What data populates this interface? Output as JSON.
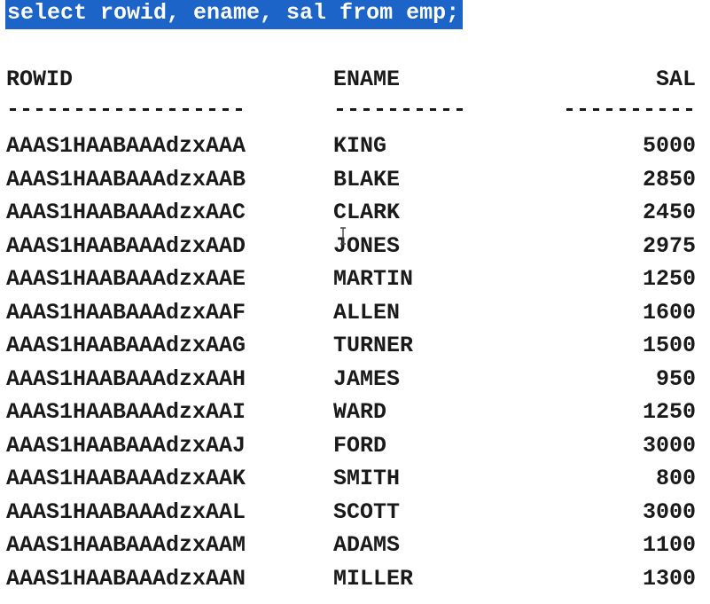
{
  "query": "select rowid, ename, sal from emp;",
  "headers": {
    "rowid": "ROWID",
    "ename": "ENAME",
    "sal": "SAL"
  },
  "separators": {
    "rowid": "------------------",
    "ename": "----------",
    "sal": "----------"
  },
  "rows": [
    {
      "rowid": "AAAS1HAABAAAdzxAAA",
      "ename": "KING",
      "sal": "5000"
    },
    {
      "rowid": "AAAS1HAABAAAdzxAAB",
      "ename": "BLAKE",
      "sal": "2850"
    },
    {
      "rowid": "AAAS1HAABAAAdzxAAC",
      "ename": "CLARK",
      "sal": "2450"
    },
    {
      "rowid": "AAAS1HAABAAAdzxAAD",
      "ename": "JONES",
      "sal": "2975"
    },
    {
      "rowid": "AAAS1HAABAAAdzxAAE",
      "ename": "MARTIN",
      "sal": "1250"
    },
    {
      "rowid": "AAAS1HAABAAAdzxAAF",
      "ename": "ALLEN",
      "sal": "1600"
    },
    {
      "rowid": "AAAS1HAABAAAdzxAAG",
      "ename": "TURNER",
      "sal": "1500"
    },
    {
      "rowid": "AAAS1HAABAAAdzxAAH",
      "ename": "JAMES",
      "sal": "950"
    },
    {
      "rowid": "AAAS1HAABAAAdzxAAI",
      "ename": "WARD",
      "sal": "1250"
    },
    {
      "rowid": "AAAS1HAABAAAdzxAAJ",
      "ename": "FORD",
      "sal": "3000"
    },
    {
      "rowid": "AAAS1HAABAAAdzxAAK",
      "ename": "SMITH",
      "sal": "800"
    },
    {
      "rowid": "AAAS1HAABAAAdzxAAL",
      "ename": "SCOTT",
      "sal": "3000"
    },
    {
      "rowid": "AAAS1HAABAAAdzxAAM",
      "ename": "ADAMS",
      "sal": "1100"
    },
    {
      "rowid": "AAAS1HAABAAAdzxAAN",
      "ename": "MILLER",
      "sal": "1300"
    }
  ],
  "colors": {
    "selection": "#1c64c8",
    "text": "#1a1a1a",
    "background": "#ffffff"
  },
  "icons": {
    "cursor": "text-cursor-icon"
  }
}
